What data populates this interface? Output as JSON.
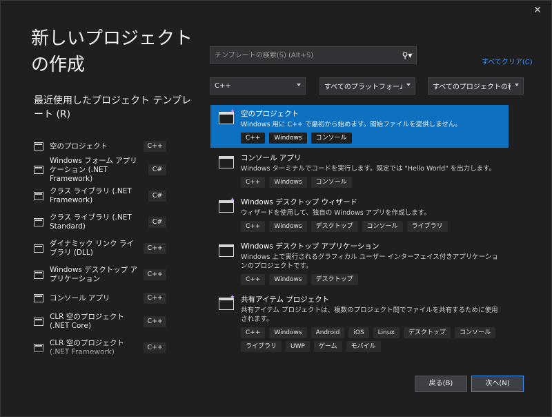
{
  "window": {
    "close_glyph": "✕"
  },
  "left": {
    "title": "新しいプロジェクトの作成",
    "recent_title": "最近使用したプロジェクト テンプレート (R)",
    "recent": [
      {
        "label": "空のプロジェクト",
        "lang": "C++"
      },
      {
        "label": "Windows フォーム アプリケーション (.NET Framework)",
        "lang": "C#"
      },
      {
        "label": "クラス ライブラリ (.NET Framework)",
        "lang": "C#"
      },
      {
        "label": "クラス ライブラリ (.NET Standard)",
        "lang": "C#"
      },
      {
        "label": "ダイナミック リンク ライブラリ (DLL)",
        "lang": "C++"
      },
      {
        "label": "Windows デスクトップ アプリケーション",
        "lang": "C++"
      },
      {
        "label": "コンソール アプリ",
        "lang": "C++"
      },
      {
        "label": "CLR 空のプロジェクト (.NET Core)",
        "lang": "C++"
      },
      {
        "label": "CLR 空のプロジェクト (.NET Framework)",
        "lang": "C++"
      }
    ]
  },
  "search": {
    "placeholder": "テンプレートの検索(S) (Alt+S)",
    "icon": "search-icon"
  },
  "clear_all": "すべてクリア(C)",
  "filters": {
    "language": "C++",
    "platform": "すべてのプラットフォーム(P)",
    "project_type": "すべてのプロジェクトの種類..."
  },
  "templates": [
    {
      "title": "空のプロジェクト",
      "desc": "Windows 用に C++ で最初から始めます。開始ファイルを提供しません。",
      "tags": [
        "C++",
        "Windows",
        "コンソール"
      ],
      "selected": true
    },
    {
      "title": "コンソール アプリ",
      "desc": "Windows ターミナルでコードを実行します。既定では \"Hello World\" を出力します。",
      "tags": [
        "C++",
        "Windows",
        "コンソール"
      ]
    },
    {
      "title": "Windows デスクトップ ウィザード",
      "desc": "ウィザードを使用して、独自の Windows アプリを作成します。",
      "tags": [
        "C++",
        "Windows",
        "デスクトップ",
        "コンソール",
        "ライブラリ"
      ]
    },
    {
      "title": "Windows デスクトップ アプリケーション",
      "desc": "Windows 上で実行されるグラフィカル ユーザー インターフェイス付きアプリケーションのプロジェクトです。",
      "tags": [
        "C++",
        "Windows",
        "デスクトップ"
      ]
    },
    {
      "title": "共有アイテム プロジェクト",
      "desc": "共有アイテム プロジェクトは、複数のプロジェクト間でファイルを共有するために使用されます。",
      "tags": [
        "C++",
        "Windows",
        "Android",
        "iOS",
        "Linux",
        "デスクトップ",
        "コンソール",
        "ライブラリ",
        "UWP",
        "ゲーム",
        "モバイル"
      ]
    }
  ],
  "buttons": {
    "back": "戻る(B)",
    "next": "次へ(N)"
  },
  "colors": {
    "accent": "#0e70c0",
    "link": "#3794ff",
    "background": "#1f1f1f"
  }
}
